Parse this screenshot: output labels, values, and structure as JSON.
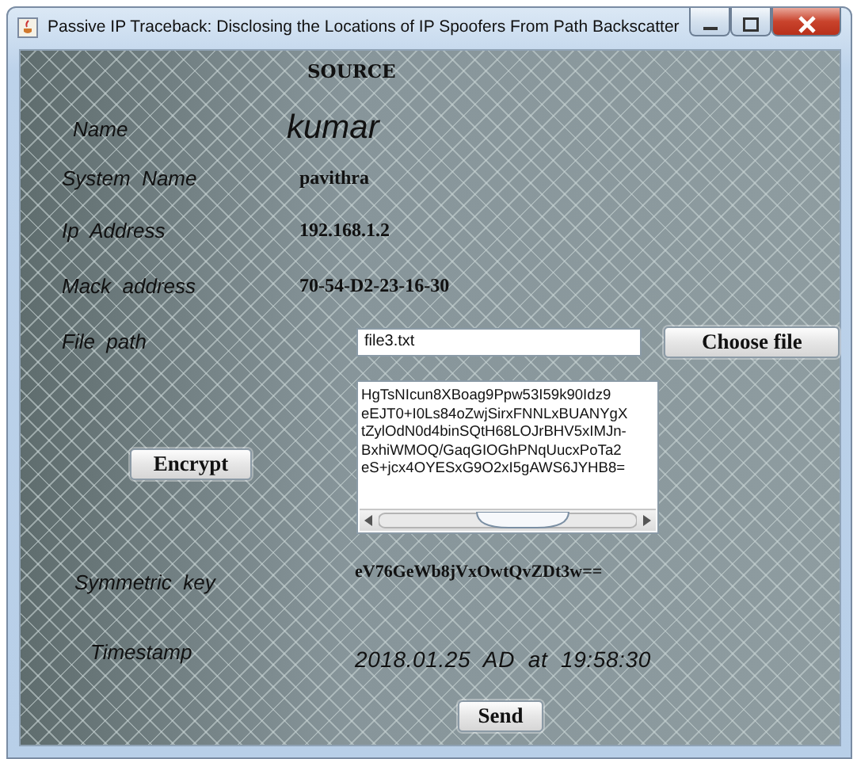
{
  "window": {
    "title": "Passive IP Traceback: Disclosing the Locations of IP Spoofers From Path Backscatter"
  },
  "heading": "SOURCE",
  "fields": [
    {
      "label": "Name",
      "value": "kumar",
      "kind": "large"
    },
    {
      "label": "System  Name",
      "value": "pavithra",
      "kind": "bold"
    },
    {
      "label": "Ip  Address",
      "value": "192.168.1.2",
      "kind": "bold"
    },
    {
      "label": "Mack  address",
      "value": "70-54-D2-23-16-30",
      "kind": "bold"
    }
  ],
  "file_path": {
    "label": "File  path",
    "value": "file3.txt",
    "button": "Choose file"
  },
  "encrypted_text": {
    "lines": [
      "HgTsNIcun8XBoag9Ppw53I59k90Idz9",
      "eEJT0+I0Ls84oZwjSirxFNNLxBUANYgX",
      "tZylOdN0d4binSQtH68LOJrBHV5xIMJn-",
      "BxhiWMOQ/GaqGIOGhPNqUucxPoTa2",
      "eS+jcx4OYESxG9O2xI5gAWS6JYHB8="
    ]
  },
  "encrypt_button": "Encrypt",
  "symmetric_key": {
    "label": "Symmetric  key",
    "value": "eV76GeWb8jVxOwtQvZDt3w=="
  },
  "timestamp": {
    "label": "Timestamp",
    "value": "2018.01.25  AD  at  19:58:30"
  },
  "send_button": "Send"
}
